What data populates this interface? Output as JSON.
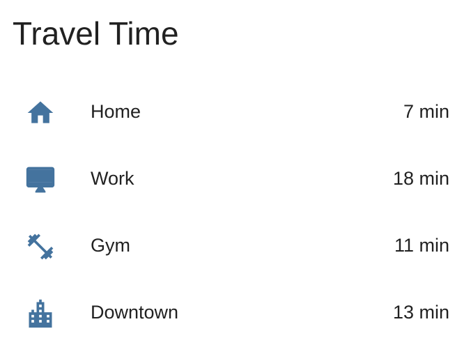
{
  "card": {
    "title": "Travel Time"
  },
  "colors": {
    "icon": "#44739e",
    "text": "#212121",
    "background": "#ffffff"
  },
  "rows": [
    {
      "icon": "home-icon",
      "label": "Home",
      "value": "7 min"
    },
    {
      "icon": "monitor-icon",
      "label": "Work",
      "value": "18 min"
    },
    {
      "icon": "dumbbell-icon",
      "label": "Gym",
      "value": "11 min"
    },
    {
      "icon": "city-icon",
      "label": "Downtown",
      "value": "13 min"
    }
  ]
}
